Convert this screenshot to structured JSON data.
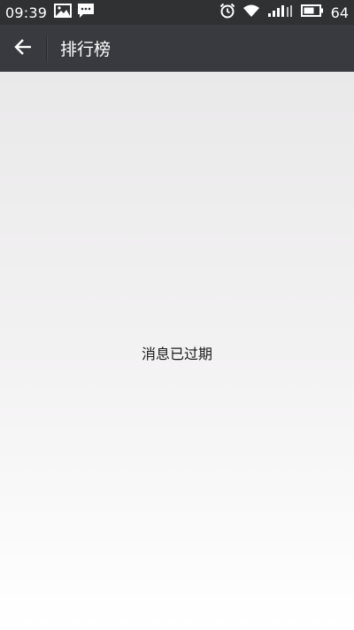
{
  "status_bar": {
    "time": "09:39",
    "battery_level": "64",
    "icons": [
      "image-icon",
      "message-icon",
      "alarm-icon",
      "wifi-icon",
      "signal-icon",
      "battery-icon"
    ]
  },
  "app_bar": {
    "title": "排行榜",
    "back_icon": "arrow-left-icon"
  },
  "main": {
    "message": "消息已过期"
  },
  "colors": {
    "status_bar_bg": "#2f3133",
    "app_bar_bg": "#393a3f",
    "content_bg_top": "#eae9ea",
    "content_bg_bottom": "#ffffff",
    "text_primary": "#1a1a1a"
  }
}
